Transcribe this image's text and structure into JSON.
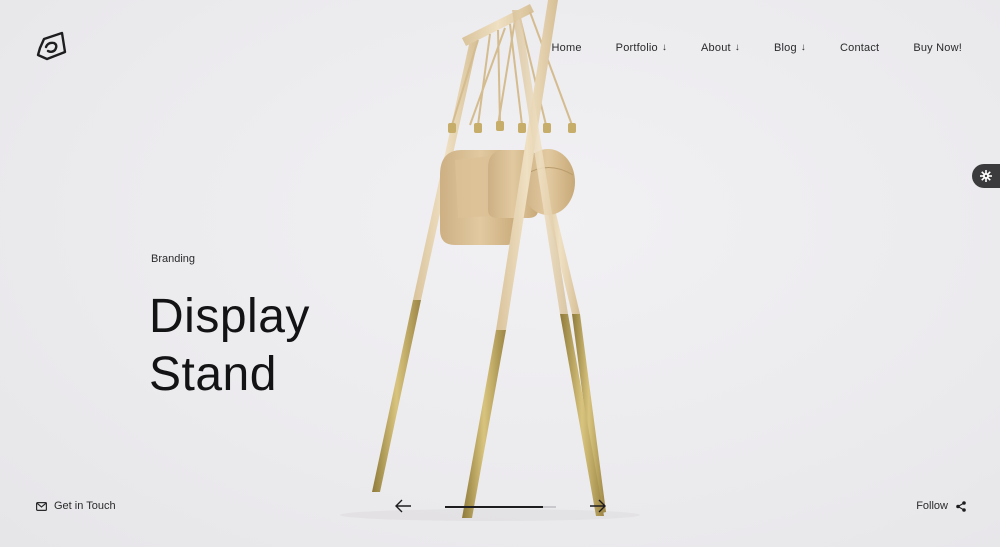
{
  "nav": {
    "items": [
      {
        "label": "Home",
        "has_dropdown": false
      },
      {
        "label": "Portfolio",
        "has_dropdown": true
      },
      {
        "label": "About",
        "has_dropdown": true
      },
      {
        "label": "Blog",
        "has_dropdown": true
      },
      {
        "label": "Contact",
        "has_dropdown": false
      },
      {
        "label": "Buy Now!",
        "has_dropdown": false
      }
    ],
    "dropdown_glyph": "↓"
  },
  "hero": {
    "category": "Branding",
    "title_line1": "Display",
    "title_line2": "Stand"
  },
  "footer": {
    "contact_label": "Get in Touch",
    "follow_label": "Follow"
  },
  "slider": {
    "progress": 0.88
  },
  "colors": {
    "background": "#ecebee",
    "text": "#1d1d1f",
    "wood": "#e3cfa9",
    "brass": "#b8a15c",
    "leather": "#d8bd92",
    "settings_tab": "#3b3b3e"
  },
  "icons": {
    "logo": "brand-logo",
    "settings": "gear-icon",
    "contact": "mail-icon",
    "prev": "arrow-left-icon",
    "next": "arrow-right-icon",
    "follow": "share-icon"
  }
}
